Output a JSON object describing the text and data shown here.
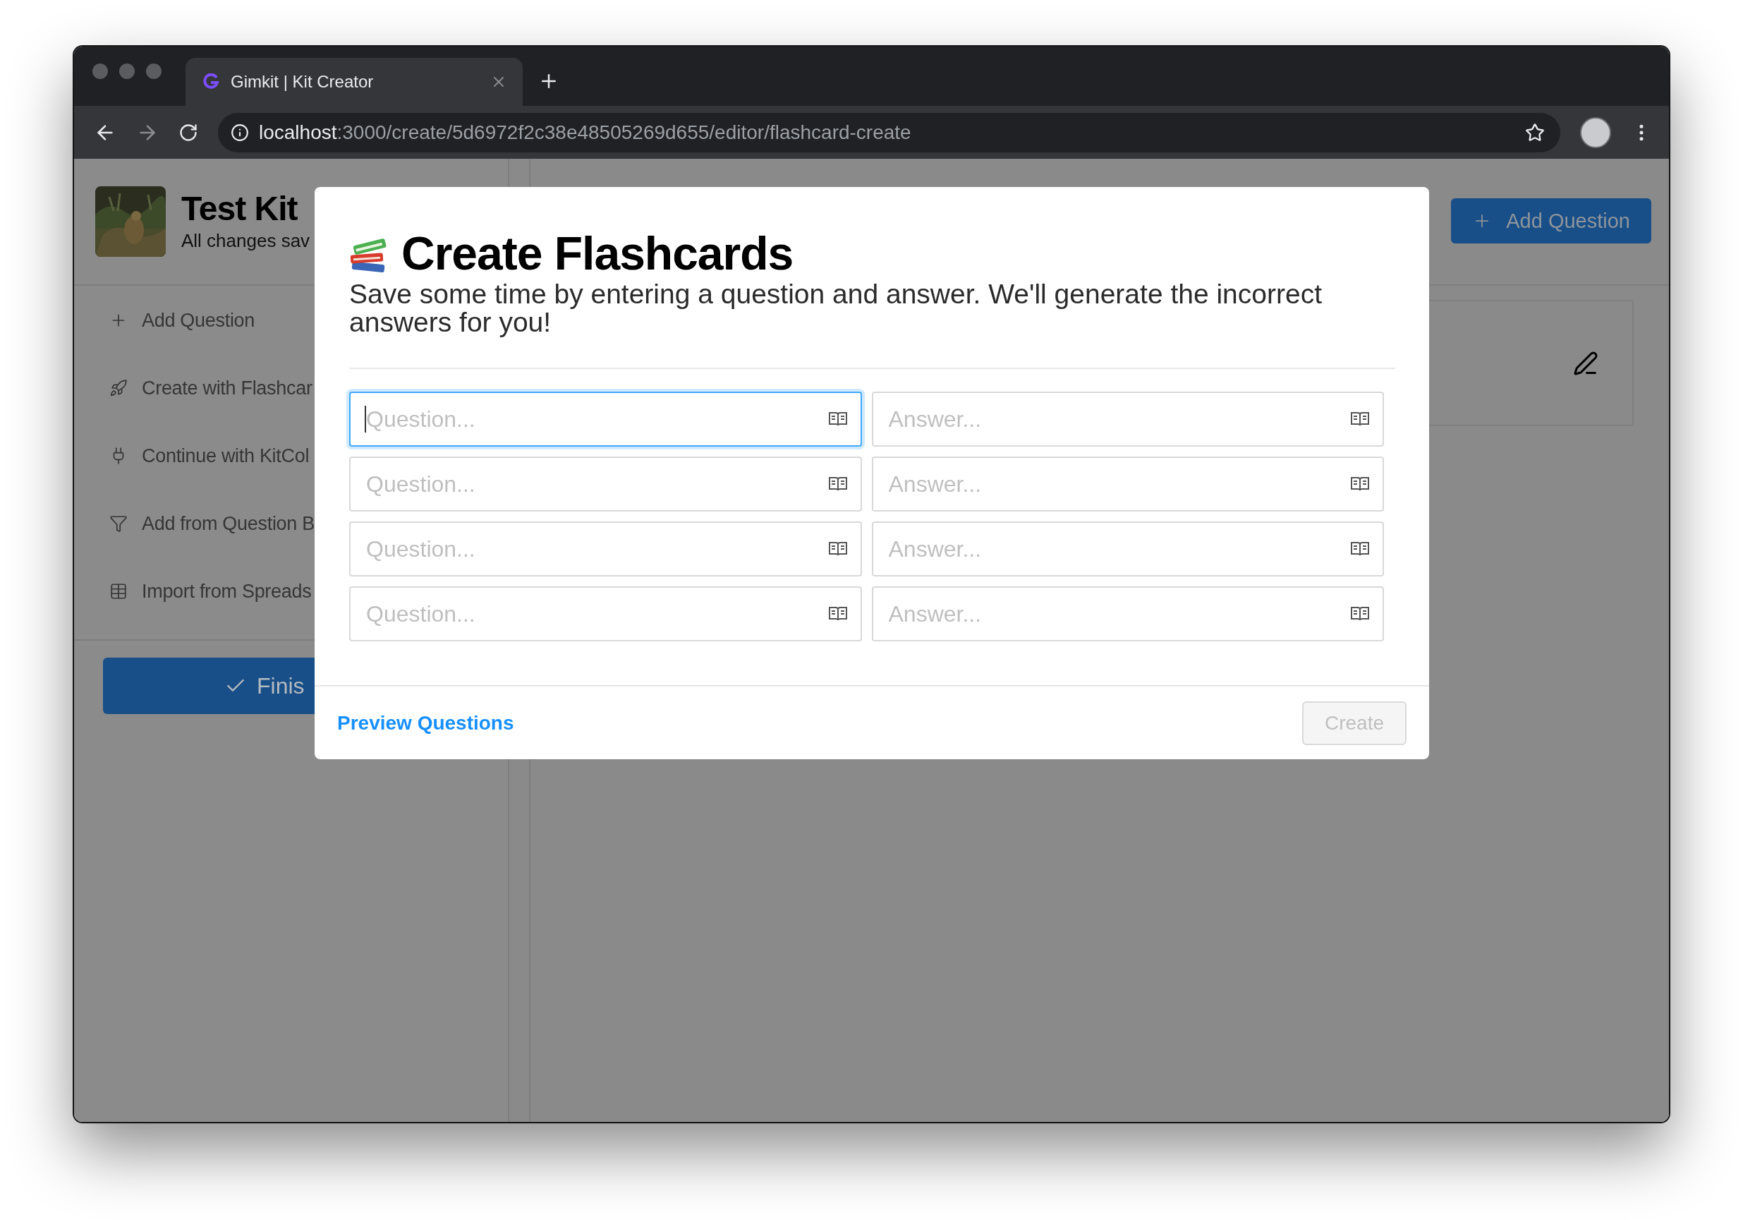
{
  "browser": {
    "tab": {
      "title": "Gimkit | Kit Creator"
    },
    "url": {
      "host": "localhost",
      "path": ":3000/create/5d6972f2c38e48505269d655/editor/flashcard-create"
    }
  },
  "kit": {
    "title": "Test Kit",
    "status": "All changes sav"
  },
  "sidebar": {
    "items": [
      {
        "kind": "plus",
        "label": "Add Question"
      },
      {
        "kind": "rocket",
        "label": "Create with Flashcar"
      },
      {
        "kind": "plug",
        "label": "Continue with KitCol"
      },
      {
        "kind": "funnel",
        "label": "Add from Question B"
      },
      {
        "kind": "table",
        "label": "Import from Spreads"
      }
    ]
  },
  "finish_button": {
    "label": "Finis"
  },
  "header_button": {
    "label": "Add Question"
  },
  "modal": {
    "title": "Create Flashcards",
    "subtitle": "Save some time by entering a question and answer. We'll generate the incorrect answers for you!",
    "rows": [
      {
        "question": {
          "placeholder": "Question...",
          "focused": true
        },
        "answer": {
          "placeholder": "Answer...",
          "focused": false
        }
      },
      {
        "question": {
          "placeholder": "Question...",
          "focused": false
        },
        "answer": {
          "placeholder": "Answer...",
          "focused": false
        }
      },
      {
        "question": {
          "placeholder": "Question...",
          "focused": false
        },
        "answer": {
          "placeholder": "Answer...",
          "focused": false
        }
      },
      {
        "question": {
          "placeholder": "Question...",
          "focused": false
        },
        "answer": {
          "placeholder": "Answer...",
          "focused": false
        }
      }
    ],
    "link": "Preview Questions",
    "create_button": {
      "label": "Create",
      "disabled": true
    }
  }
}
